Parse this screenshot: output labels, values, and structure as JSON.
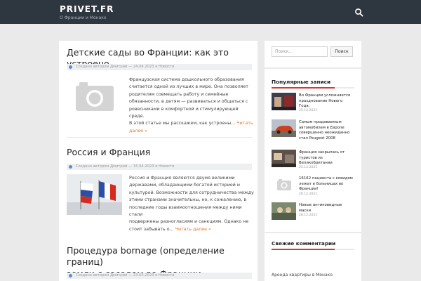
{
  "header": {
    "site_title": "PRIVET.FR",
    "tagline": "О Франции и Монако",
    "search_icon": "search-icon"
  },
  "colors": {
    "header_bg": "#2e363f",
    "accent": "#e8741a",
    "widget_accent": "#dd3333",
    "meta_dot": "#5b8ec9"
  },
  "posts": [
    {
      "title": "Детские сады во Франции: как это устроено",
      "meta": "Создано автором Дмитрий — 24.04.2023 в Новости",
      "thumb": "camera-placeholder-icon",
      "excerpt_lines": [
        "Французская система дошкольного образования",
        "считается одной из лучших в мире. Она позволяет",
        "родителям совмещать работу и семейные",
        "обязанности, в детям — развиваться и общаться с",
        "ровесниками в комфортной и стимулирующей среде.",
        "В этой статье мы расскажем, как устроены..."
      ],
      "more_a": "Читать",
      "more_b": "далее »"
    },
    {
      "title": "Россия и Франция",
      "meta": "Создано автором Дмитрий — 15.04.2023 в Новости",
      "thumb": "flags-photo",
      "excerpt_lines": [
        "Россия и Франция являются двумя великими",
        "державами, обладающими богатой историей и",
        "культурой. Возможности для сотрудничества между",
        "этими странами значительны, но, к сожалению, в",
        "последние годы взаимоотношения между ними стали",
        "подвержены разногласиям и санкциям. Однако не",
        "стоит забывать о..."
      ],
      "more_a": "Читать далее »"
    },
    {
      "title_line1": "Процедура bornage (определение границ)",
      "title_line2": "земли с соседом во Франции",
      "meta": "Создано автором Дмитрий — 23.03.2023 в Новости"
    }
  ],
  "sidebar": {
    "search_placeholder": "Поиск...",
    "search_button": "Поиск",
    "popular_title": "Популярные записи",
    "popular": [
      {
        "title_lines": [
          "Во Франции усложняется",
          "празднование Нового",
          "Года."
        ],
        "date": "25.12.2021",
        "thumb": "photo"
      },
      {
        "title_lines": [
          "Самым продаваемым",
          "автомобилем в Европе",
          "совершенно неожиданно",
          "стал Peugeot 2008"
        ],
        "date": "25.12.2021",
        "thumb": "photo"
      },
      {
        "title_lines": [
          "Франция закрылась от",
          "туристов из",
          "Великобритании"
        ],
        "date": "25.12.2021",
        "thumb": "photo"
      },
      {
        "title_lines": [
          "16162 пациента с ковидом",
          "лежат в больницах во",
          "Франции!"
        ],
        "date": "26.12.2021",
        "thumb": "camera-placeholder-icon"
      },
      {
        "title_lines": [
          "Новые антиковидные",
          "маски"
        ],
        "date": "28.12.2021",
        "thumb": "photo"
      }
    ],
    "comments_title": "Свежие комментарии",
    "comment_link": "Аренда квартиры в Монако"
  }
}
